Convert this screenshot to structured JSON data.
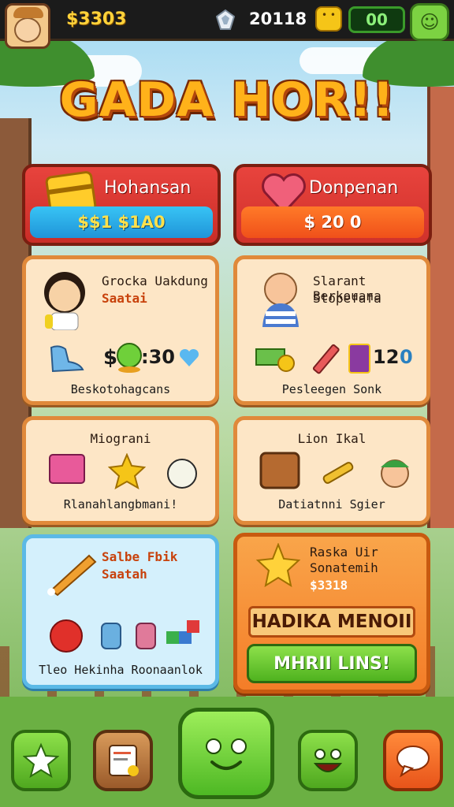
{
  "topbar": {
    "coins": "$3303",
    "score": "20118",
    "energy": "00"
  },
  "title": "GADA HOR!!",
  "header_cards": [
    {
      "label": "Hohansan",
      "value": "$$1 $1A0"
    },
    {
      "label": "Donpenan",
      "value": "$ 20 0"
    }
  ],
  "cards": {
    "c1": {
      "title": "Grocka Uakdung",
      "sub": "Saatai",
      "value": "$",
      "value2": ":30",
      "footer": "Beskotohagcans"
    },
    "c2": {
      "title": "Slarant Berkouana",
      "sub": "Stopefafa",
      "value": "12",
      "value2": "0",
      "footer": "Pesleegen Sonk"
    },
    "c3": {
      "title": "Miograni",
      "footer": "Rlanahlangbmani!"
    },
    "c4": {
      "title": "Lion Ikal",
      "footer": "Datiatnni Sgier"
    },
    "c5": {
      "title": "Salbe Fbik",
      "sub": "Saatah",
      "footer": "Tleo Hekinha Roonaanlok"
    },
    "c6": {
      "title": "Raska Uir",
      "sub": "Sonatemih",
      "price": "$3318",
      "banner": "HADIKA MENOII",
      "button": "MHRII LINS!"
    }
  },
  "colors": {
    "coin": "#ffd23a",
    "energy": "#8cf07a",
    "title": "#ffb21a",
    "accent_green": "#4fb21f",
    "accent_red": "#e8433d",
    "accent_blue": "#38c4f5",
    "accent_orange": "#f47d28"
  },
  "icons": {
    "topbar": [
      "avatar",
      "gem-icon",
      "block-icon",
      "face-icon"
    ],
    "nav": [
      "star-icon",
      "document-icon",
      "home-face-icon",
      "smile-face-icon",
      "chat-icon"
    ]
  }
}
